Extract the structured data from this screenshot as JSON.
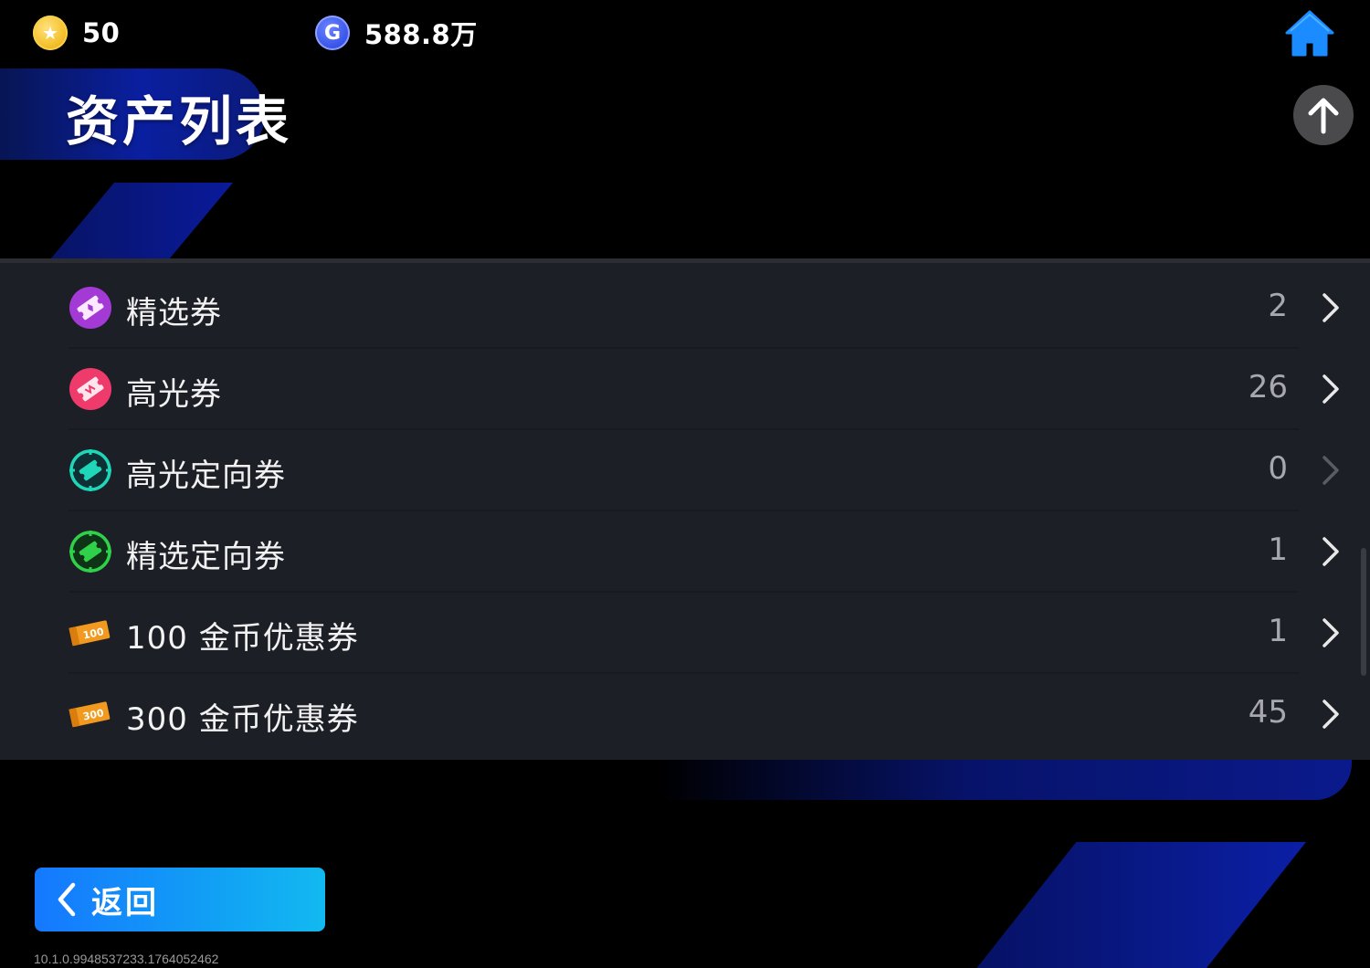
{
  "top_bar": {
    "gold": {
      "icon": "star-coin-icon",
      "value": "50"
    },
    "gem": {
      "icon": "g-coin-icon",
      "value": "588.8万"
    },
    "home_icon": "home-icon"
  },
  "title": "资产列表",
  "scroll_top_icon": "arrow-up-icon",
  "assets": [
    {
      "label": "精选券",
      "count": "2",
      "icon": "featured-ticket-icon",
      "icon_color": "#a43ad6"
    },
    {
      "label": "高光券",
      "count": "26",
      "icon": "highlight-ticket-icon",
      "icon_color": "#ee3b6c"
    },
    {
      "label": "高光定向券",
      "count": "0",
      "icon": "highlight-target-ticket-icon",
      "icon_color": "#1fd6b8"
    },
    {
      "label": "精选定向券",
      "count": "1",
      "icon": "featured-target-ticket-icon",
      "icon_color": "#2fd14a"
    },
    {
      "label": "100 金币优惠券",
      "count": "1",
      "icon": "coupon-100-icon",
      "icon_color": "#f29a1f",
      "badge": "100"
    },
    {
      "label": "300 金币优惠券",
      "count": "45",
      "icon": "coupon-300-icon",
      "icon_color": "#f29a1f",
      "badge": "300"
    }
  ],
  "back_button": {
    "label": "返回",
    "icon": "chevron-left-icon"
  },
  "version": "10.1.0.9948537233.1764052462",
  "colors": {
    "background": "#000000",
    "list_background": "#1d1f26",
    "accent_blue": "#1578ff",
    "count_grey": "#a7a8ad"
  }
}
